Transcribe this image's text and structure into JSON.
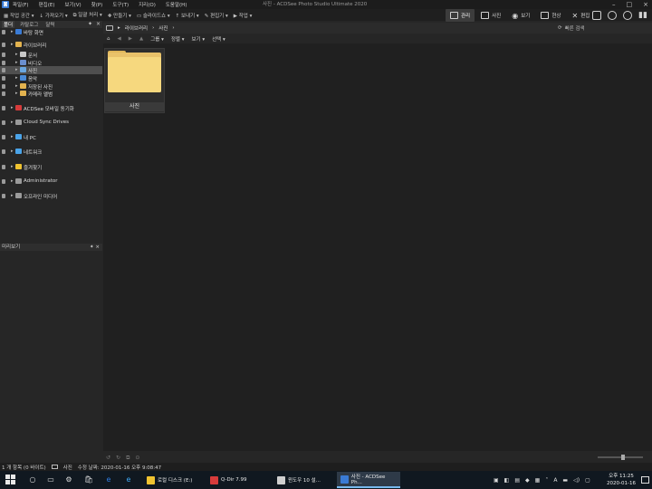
{
  "app": {
    "title": "사진 - ACDSee Photo Studio Ultimate 2020"
  },
  "menu": [
    "파일(F)",
    "편집(E)",
    "보기(V)",
    "찾(P)",
    "도구(T)",
    "지리(O)",
    "도움말(H)"
  ],
  "toolbar": [
    "작업 공간",
    "가져오기",
    "일괄 처리",
    "만들기",
    "슬라이드쇼",
    "보내기",
    "편집기",
    "작업"
  ],
  "modes": [
    {
      "label": "관리",
      "active": true
    },
    {
      "label": "사진",
      "active": false
    },
    {
      "label": "보기",
      "active": false
    },
    {
      "label": "현상",
      "active": false
    },
    {
      "label": "편집",
      "active": false
    }
  ],
  "panel_tabs": [
    "폴더",
    "카탈로그",
    "달력"
  ],
  "tree": [
    {
      "label": "바탕 화면",
      "color": "#3a7bd5",
      "indent": 0,
      "selected": false
    },
    {
      "label": "라이브러리",
      "color": "#e3b34f",
      "indent": 0,
      "selected": false
    },
    {
      "label": "문서",
      "color": "#c8c8c8",
      "indent": 1,
      "selected": false
    },
    {
      "label": "비디오",
      "color": "#6a8fcf",
      "indent": 1,
      "selected": false
    },
    {
      "label": "사진",
      "color": "#6aa7e0",
      "indent": 1,
      "selected": true
    },
    {
      "label": "음악",
      "color": "#4a8ad6",
      "indent": 1,
      "selected": false
    },
    {
      "label": "저장된 사진",
      "color": "#e3b34f",
      "indent": 1,
      "selected": false
    },
    {
      "label": "카메라 앨범",
      "color": "#e3b34f",
      "indent": 1,
      "selected": false
    },
    {
      "label": "ACDSee 모바일 동기화",
      "color": "#d63b3b",
      "indent": 0,
      "selected": false
    },
    {
      "label": "Cloud Sync Drives",
      "color": "#9a9a9a",
      "indent": 0,
      "selected": false
    },
    {
      "label": "내 PC",
      "color": "#4aa3e8",
      "indent": 0,
      "selected": false
    },
    {
      "label": "네트워크",
      "color": "#4aa3e8",
      "indent": 0,
      "selected": false
    },
    {
      "label": "즐겨찾기",
      "color": "#f0c330",
      "indent": 0,
      "selected": false
    },
    {
      "label": "Administrator",
      "color": "#9a9a9a",
      "indent": 0,
      "selected": false
    },
    {
      "label": "오프라인 미디어",
      "color": "#9a9a9a",
      "indent": 0,
      "selected": false
    }
  ],
  "preview": {
    "title": "미리보기"
  },
  "path": {
    "root": "라이브러리",
    "current": "사진"
  },
  "search": {
    "placeholder": "빠른 검색"
  },
  "filters": [
    "그룹",
    "정렬",
    "보기",
    "선택"
  ],
  "thumbnail": {
    "label": "사진"
  },
  "status": {
    "count": "1 개 항목 (0 바이트)",
    "folder": "사진",
    "modified": "수정 날짜: 2020-01-16 오후 9:08:47"
  },
  "taskbar": {
    "apps": [
      {
        "label": "로컬 디스크 (E:)",
        "color": "#f0c330",
        "active": false
      },
      {
        "label": "Q-Dir 7.99",
        "color": "#d63b3b",
        "active": false
      },
      {
        "label": "윈도우 10 설...",
        "color": "#cfcfcf",
        "active": false
      },
      {
        "label": "사진 - ACDSee Ph...",
        "color": "#3a7bd5",
        "active": true
      }
    ],
    "time": "오후 11:25",
    "date": "2020-01-16"
  }
}
